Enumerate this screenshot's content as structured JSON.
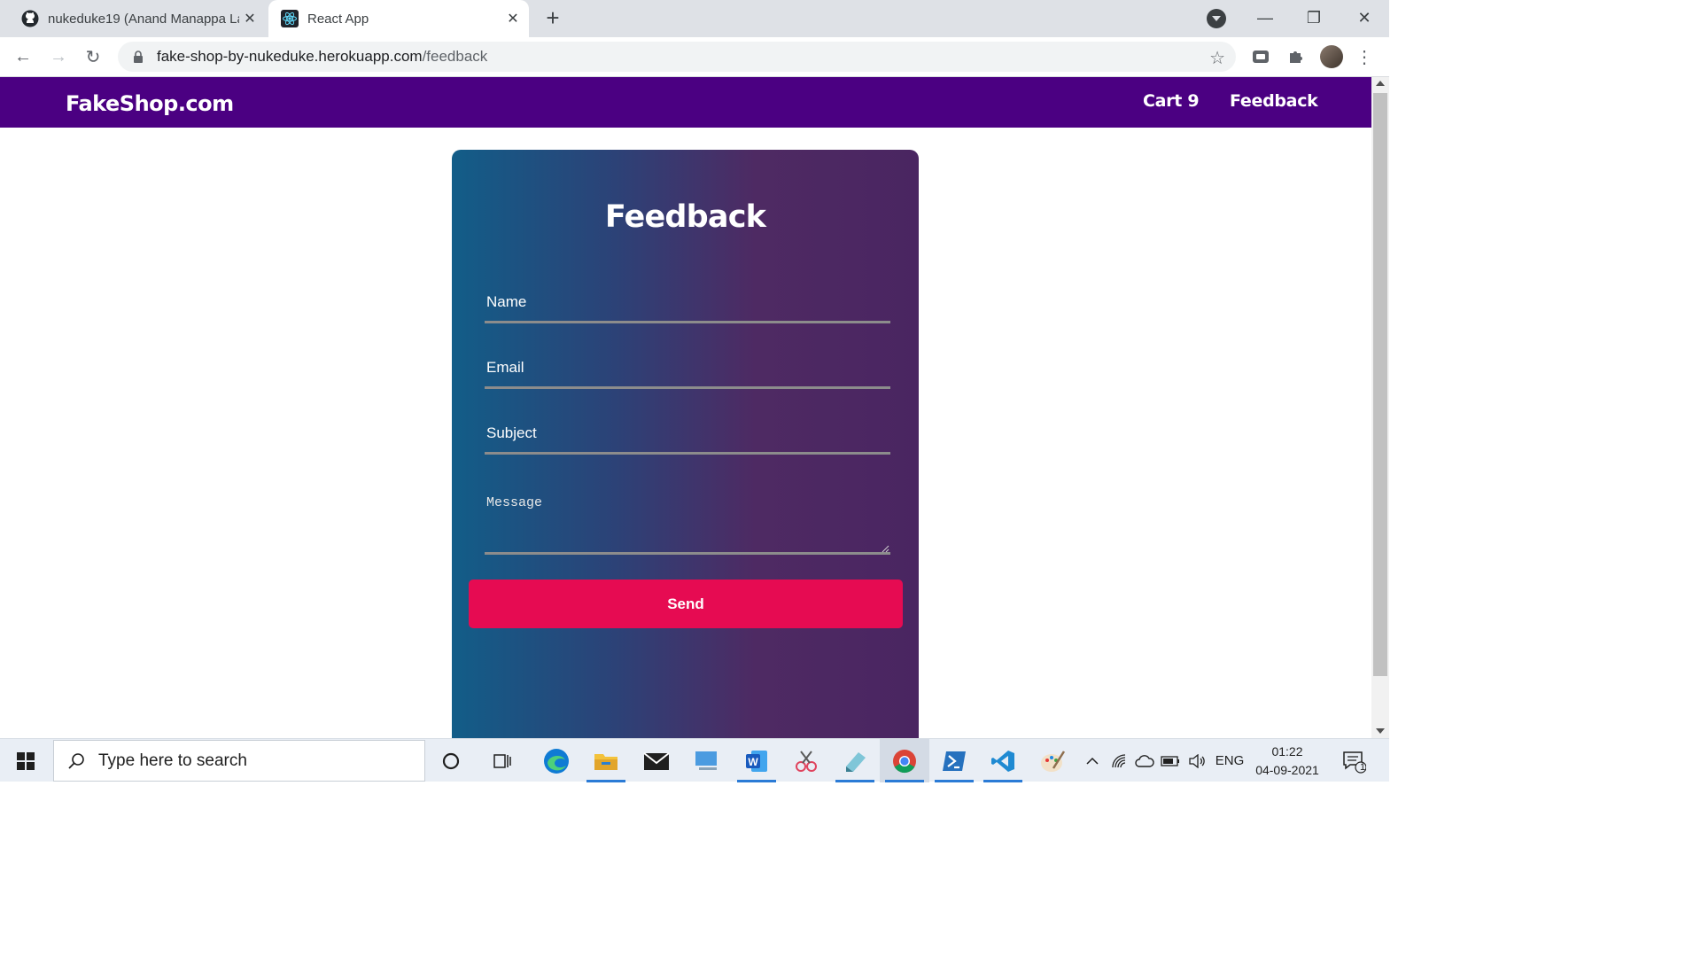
{
  "browser": {
    "tabs": [
      {
        "title": "nukeduke19 (Anand Manappa La",
        "icon": "github-icon"
      },
      {
        "title": "React App",
        "icon": "react-icon"
      }
    ],
    "address": {
      "host": "fake-shop-by-nukeduke.herokuapp.com",
      "path": "/feedback"
    }
  },
  "site": {
    "brand": "FakeShop.com",
    "nav": {
      "cart": "Cart 9",
      "feedback": "Feedback"
    }
  },
  "form": {
    "title": "Feedback",
    "name_placeholder": "Name",
    "email_placeholder": "Email",
    "subject_placeholder": "Subject",
    "message_placeholder": "Message",
    "send_label": "Send"
  },
  "taskbar": {
    "search_placeholder": "Type here to search",
    "language": "ENG",
    "time": "01:22",
    "date": "04-09-2021",
    "notification_count": "1"
  },
  "colors": {
    "site_nav": "#4b0082",
    "card_gradient_start": "#125d88",
    "card_gradient_end": "#4a2561",
    "send_button": "#e60b52"
  }
}
